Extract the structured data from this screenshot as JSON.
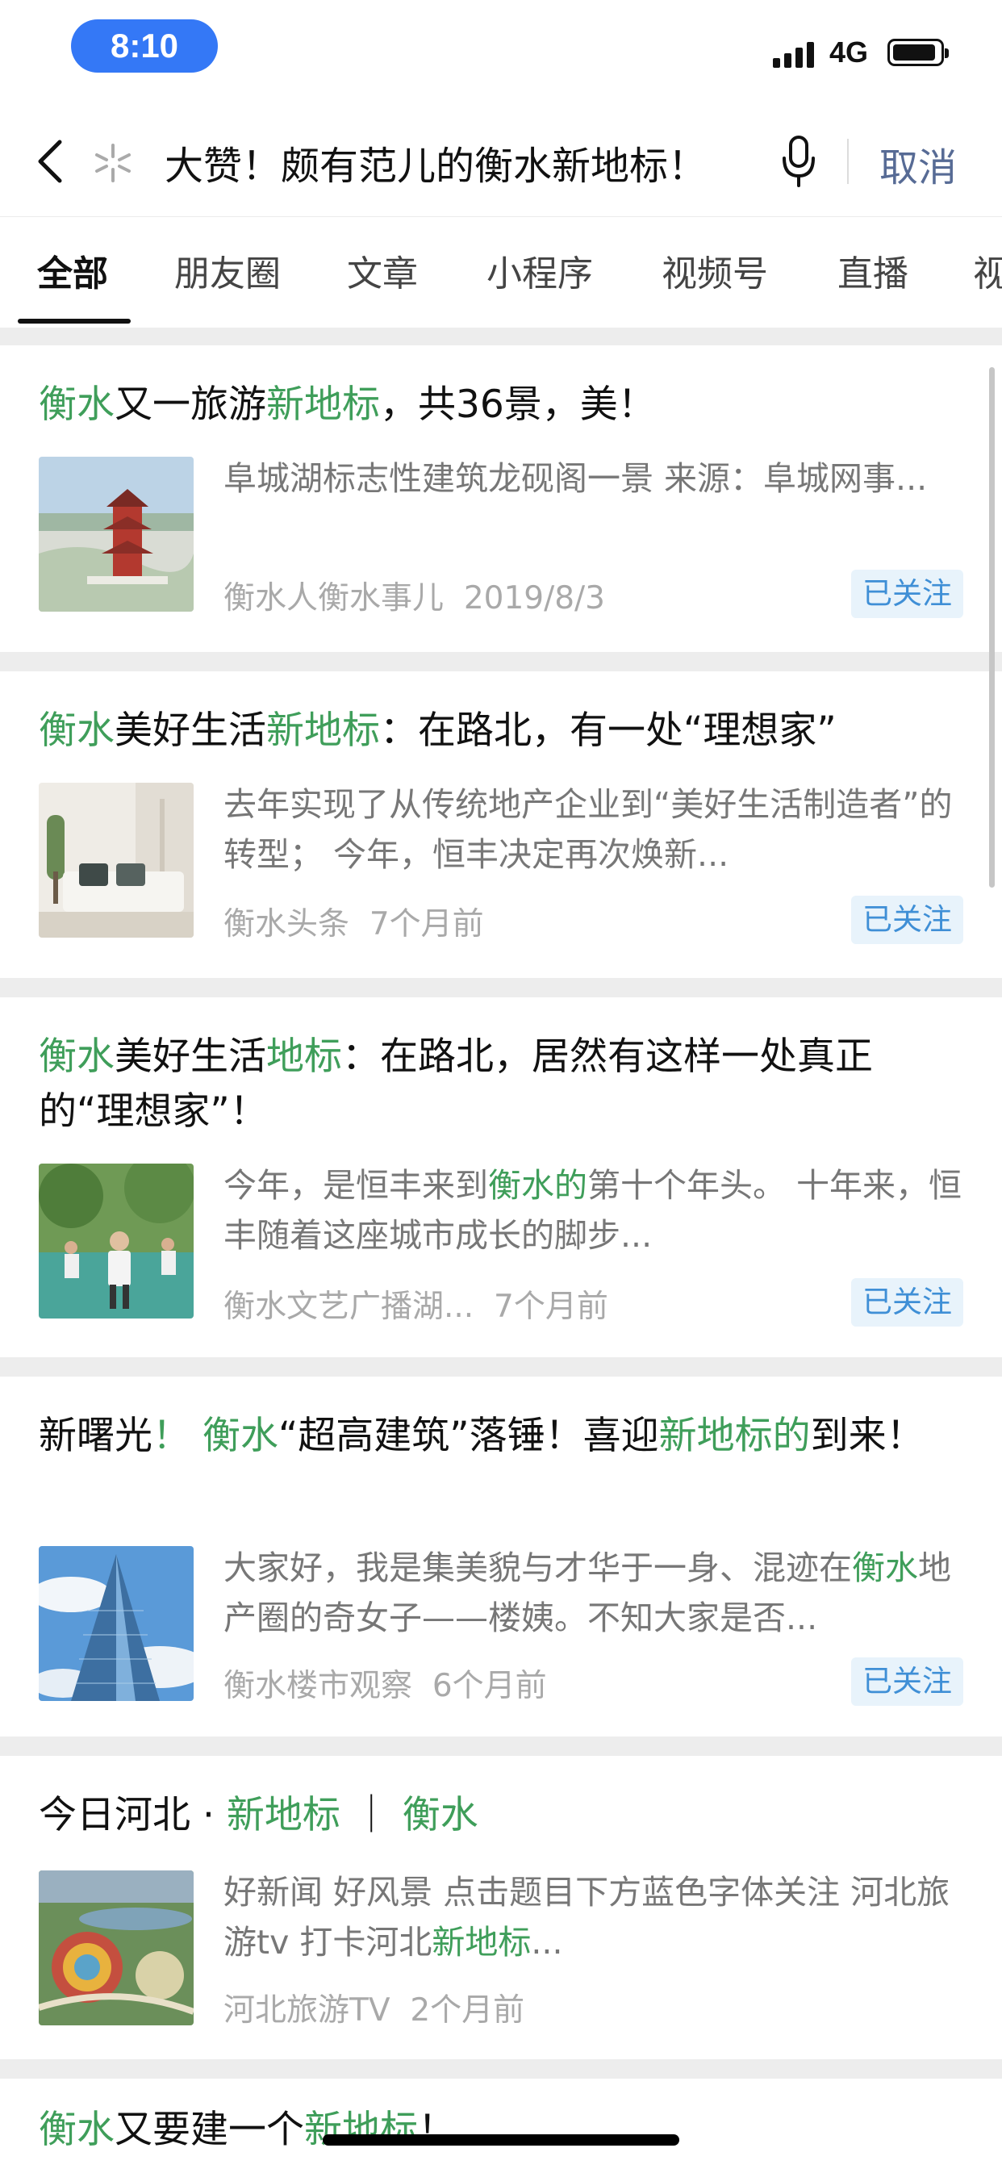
{
  "status_bar": {
    "time": "8:10",
    "network": "4G"
  },
  "search": {
    "query": "大赞！颇有范儿的衡水新地标！",
    "cancel_label": "取消"
  },
  "tabs": [
    {
      "label": "全部"
    },
    {
      "label": "朋友圈"
    },
    {
      "label": "文章"
    },
    {
      "label": "小程序"
    },
    {
      "label": "视频号"
    },
    {
      "label": "直播"
    },
    {
      "label": "视"
    }
  ],
  "results": [
    {
      "title_parts": [
        "衡水",
        "又一旅游",
        "新地标",
        "，共36景，美！"
      ],
      "snippet_parts": [
        "阜城湖标志性建筑龙砚阁一景 来源：阜城网事..."
      ],
      "source": "衡水人衡水事儿",
      "time": "2019/8/3",
      "badge": "已关注",
      "thumb_icon": "pavilion-thumbnail"
    },
    {
      "title_parts": [
        "衡水",
        "美好生活",
        "新地标",
        "：在路北，有一处“理想家”"
      ],
      "snippet_parts": [
        "去年实现了从传统地产企业到“美好生活制造者”的转型； 今年，恒丰决定再次焕新..."
      ],
      "source": "衡水头条",
      "time": "7个月前",
      "badge": "已关注",
      "thumb_icon": "living-room-thumbnail"
    },
    {
      "title_parts": [
        "衡水",
        "美好生活",
        "地标",
        "：在路北，居然有这样一处真正的“理想家”！"
      ],
      "snippet_parts": [
        "今年，是恒丰来到",
        "衡水的",
        "第十个年头。 十年来，恒丰随着这座城市成长的脚步..."
      ],
      "source": "衡水文艺广播湖...",
      "time": "7个月前",
      "badge": "已关注",
      "thumb_icon": "children-running-thumbnail"
    },
    {
      "title_parts": [
        "新曙光",
        "！ 衡水",
        "“超高建筑”落锤！喜迎",
        "新地标的",
        "到来！"
      ],
      "snippet_parts": [
        "大家好，我是集美貌与才华于一身、混迹在",
        "衡水",
        "地产圈的奇女子——楼姨。不知大家是否..."
      ],
      "source": "衡水楼市观察",
      "time": "6个月前",
      "badge": "已关注",
      "thumb_icon": "skyscraper-thumbnail"
    },
    {
      "title_parts": [
        "今日河北 · ",
        "新地标",
        "｜",
        "衡水"
      ],
      "snippet_parts": [
        "好新闻 好风景 点击题目下方蓝色字体关注 河北旅游tv 打卡河北",
        "新地标",
        "..."
      ],
      "source": "河北旅游TV",
      "time": "2个月前",
      "badge": "",
      "thumb_icon": "aerial-park-thumbnail"
    },
    {
      "title_parts": [
        "衡水",
        "又要建一个",
        "新地标",
        "！"
      ],
      "snippet_parts": [],
      "source": "",
      "time": "",
      "badge": "",
      "thumb_icon": ""
    }
  ]
}
